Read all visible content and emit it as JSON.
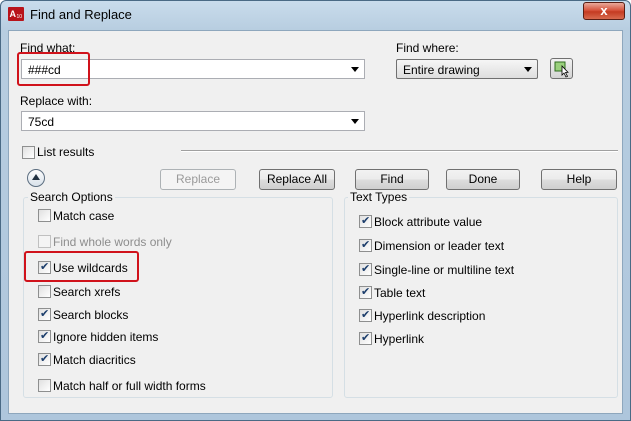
{
  "window": {
    "title": "Find and Replace",
    "icon": "autocad-icon",
    "close_symbol": "x"
  },
  "find_what": {
    "label": "Find what:",
    "value": "###cd"
  },
  "replace_with": {
    "label": "Replace with:",
    "value": "75cd"
  },
  "find_where": {
    "label": "Find where:",
    "value": "Entire drawing",
    "pick_icon": "select-objects-icon"
  },
  "list_results": {
    "label": "List results",
    "checked": false
  },
  "buttons": {
    "replace": "Replace",
    "replace_all": "Replace All",
    "find": "Find",
    "done": "Done",
    "help": "Help"
  },
  "search_options": {
    "title": "Search Options",
    "items": [
      {
        "label": "Match case",
        "checked": false,
        "enabled": true
      },
      {
        "label": "Find whole words only",
        "checked": false,
        "enabled": false
      },
      {
        "label": "Use wildcards",
        "checked": true,
        "enabled": true
      },
      {
        "label": "Search xrefs",
        "checked": false,
        "enabled": true
      },
      {
        "label": "Search blocks",
        "checked": true,
        "enabled": true
      },
      {
        "label": "Ignore hidden items",
        "checked": true,
        "enabled": true
      },
      {
        "label": "Match diacritics",
        "checked": true,
        "enabled": true
      },
      {
        "label": "Match half or full width forms",
        "checked": false,
        "enabled": true
      }
    ]
  },
  "text_types": {
    "title": "Text Types",
    "items": [
      {
        "label": "Block attribute value",
        "checked": true
      },
      {
        "label": "Dimension or leader text",
        "checked": true
      },
      {
        "label": "Single-line or multiline text",
        "checked": true
      },
      {
        "label": "Table text",
        "checked": true
      },
      {
        "label": "Hyperlink description",
        "checked": true
      },
      {
        "label": "Hyperlink",
        "checked": true
      }
    ]
  },
  "colors": {
    "highlight": "#d0121b",
    "close_button": "#c43b22",
    "accent": "#1b3d6b"
  }
}
